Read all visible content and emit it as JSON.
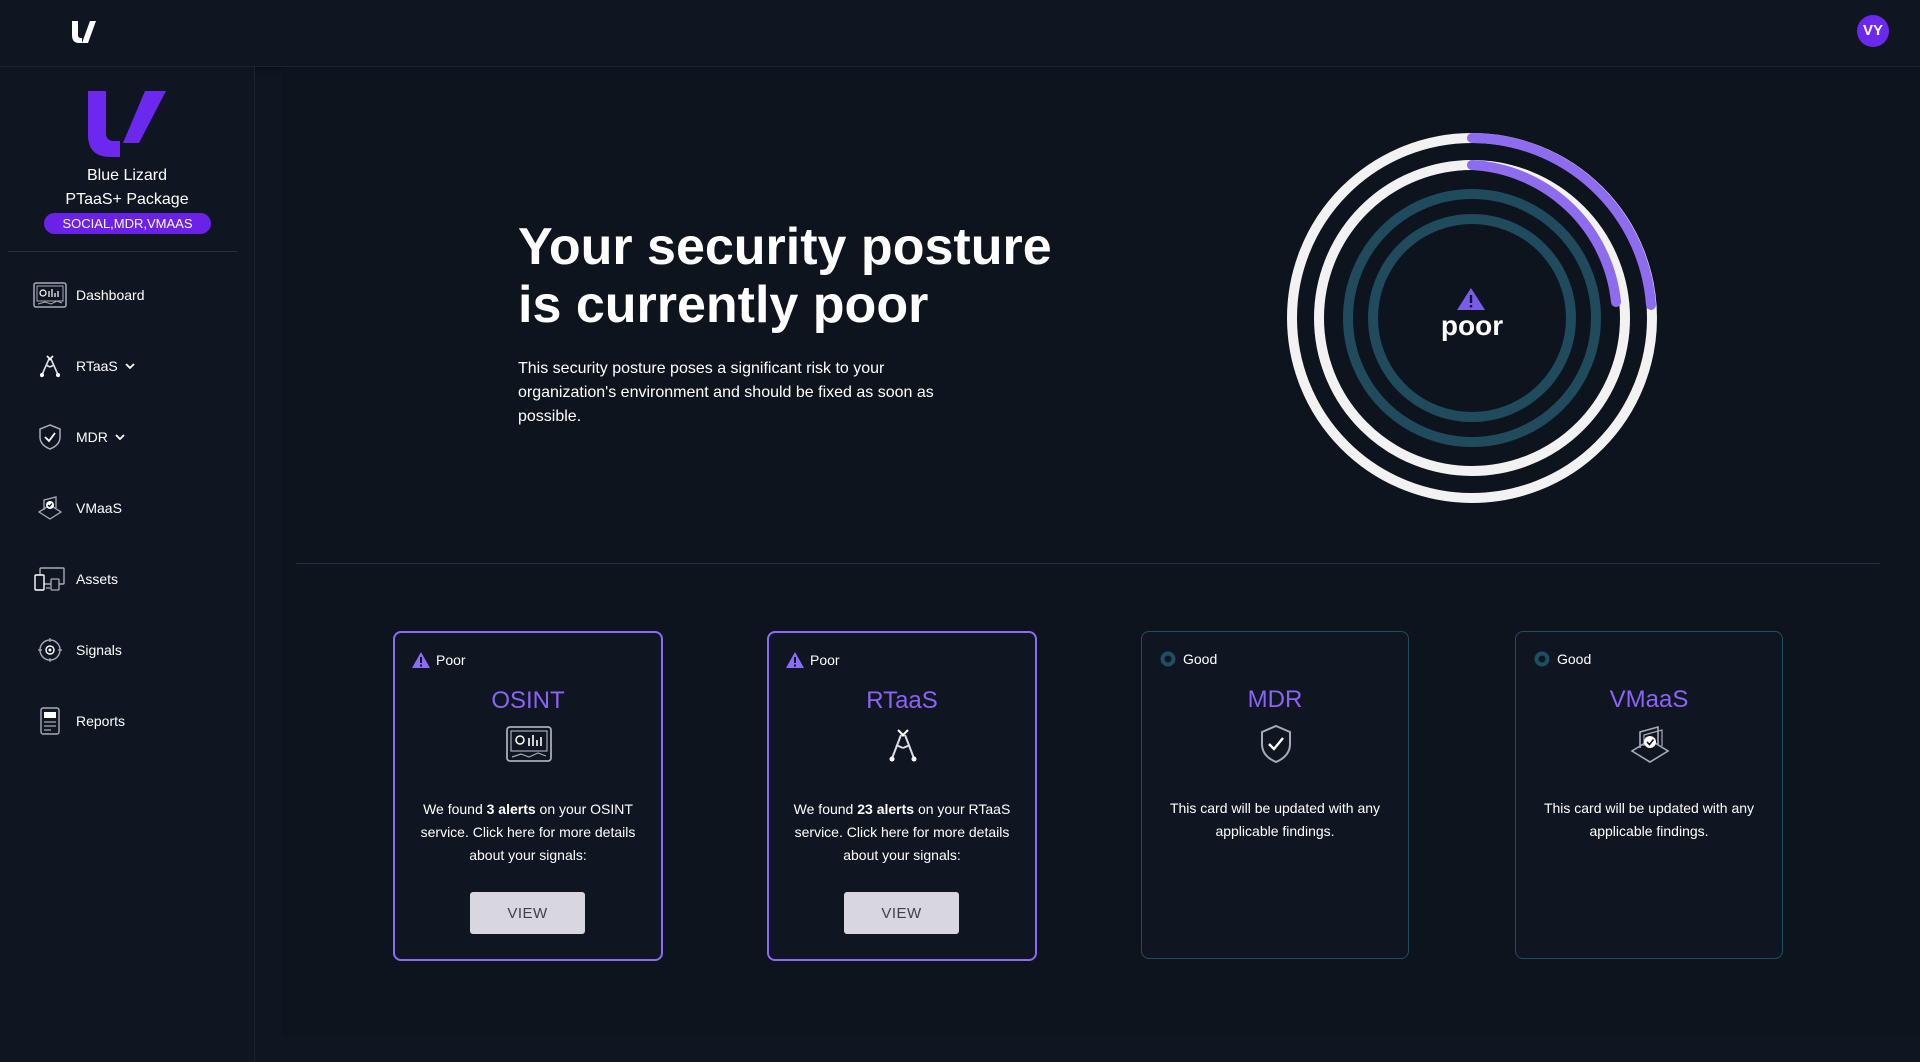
{
  "header": {
    "avatar_initials": "VY"
  },
  "sidebar": {
    "org_name": "Blue Lizard",
    "package_name": "PTaaS+ Package",
    "services_badge": "SOCIAL,MDR,VMAAS",
    "items": [
      {
        "label": "Dashboard",
        "icon": "dashboard-icon"
      },
      {
        "label": "RTaaS",
        "icon": "rtaas-icon",
        "has_chevron": true
      },
      {
        "label": "MDR",
        "icon": "shield-check-icon",
        "has_chevron": true
      },
      {
        "label": "VMaaS",
        "icon": "vmaas-icon"
      },
      {
        "label": "Assets",
        "icon": "assets-icon"
      },
      {
        "label": "Signals",
        "icon": "signals-icon"
      },
      {
        "label": "Reports",
        "icon": "reports-icon"
      }
    ]
  },
  "hero": {
    "title_line1": "Your security posture",
    "title_line2": "is currently poor",
    "description": "This security posture poses a significant risk to your organization's environment and should be fixed as soon as possible.",
    "gauge_label": "poor"
  },
  "cards": [
    {
      "status": "Poor",
      "title": "OSINT",
      "text_before": "We found ",
      "text_bold": "3 alerts",
      "text_after": " on your OSINT service. Click here for more details about your signals:",
      "button": "VIEW"
    },
    {
      "status": "Poor",
      "title": "RTaaS",
      "text_before": "We found ",
      "text_bold": "23 alerts",
      "text_after": " on your RTaaS service. Click here for more details about your signals:",
      "button": "VIEW"
    },
    {
      "status": "Good",
      "title": "MDR",
      "text": "This card will be updated with any applicable findings."
    },
    {
      "status": "Good",
      "title": "VMaaS",
      "text": "This card will be updated with any applicable findings."
    }
  ],
  "colors": {
    "background": "#0f1621",
    "accent_purple": "#8b63f6",
    "badge_purple": "#6b21e8",
    "ring_teal": "#1f4b5c",
    "ring_white": "#f2f2f2",
    "good_status": "#1f4f5f"
  }
}
